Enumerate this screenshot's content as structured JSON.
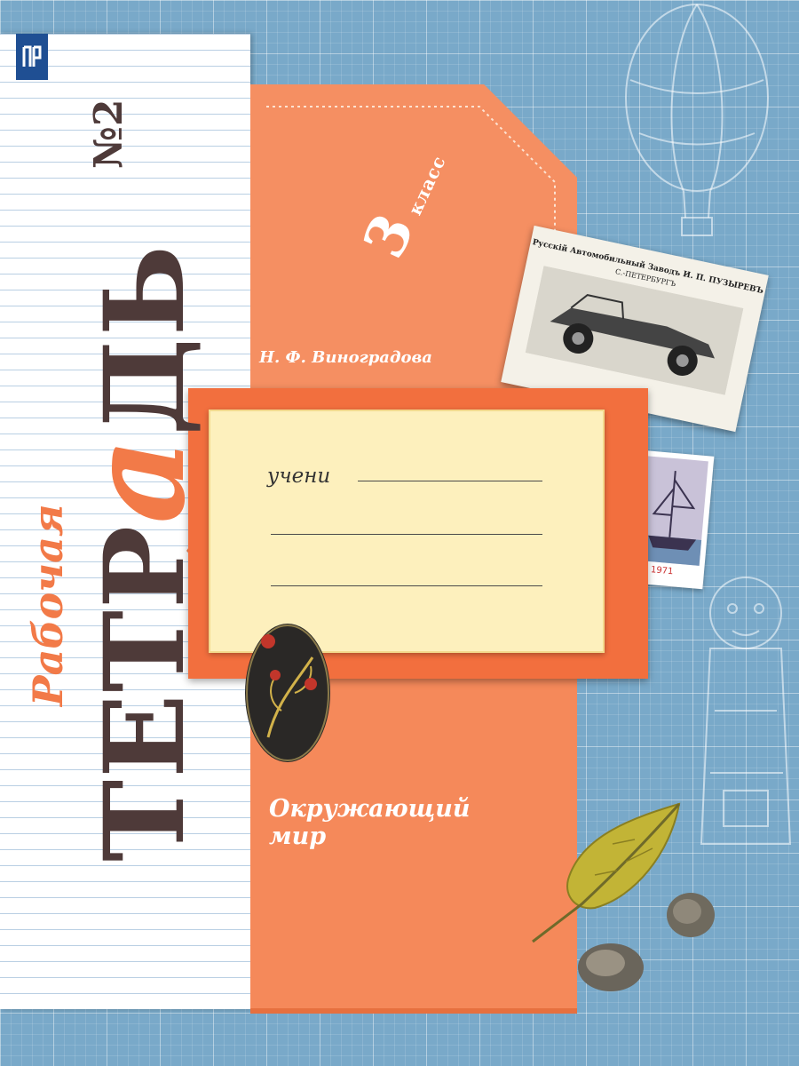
{
  "book": {
    "label": "Рабочая",
    "title_part1": "ТЕТР",
    "title_accent": "а",
    "title_part2": "ДЬ",
    "number": "№2",
    "grade_number": "3",
    "grade_word": "класс",
    "author": "Н. Ф. Виноградова",
    "subject_line1": "Окружающий",
    "subject_line2": "мир"
  },
  "card": {
    "student_label": "учени"
  },
  "decorations": {
    "postcard_title": "Русскiй Автомобильный Заводъ И. П. ПУЗЫРЕВЪ",
    "postcard_subtitle": "С.-ПЕТЕРБУРГЪ",
    "stamp_year": "1971"
  },
  "colors": {
    "background": "#79a9c9",
    "envelope": "#f5895a",
    "accent": "#f27a48",
    "title": "#4e3a39",
    "card": "#fdf0bd",
    "publisher": "#1f4f93"
  },
  "icons": [
    "publisher-logo-icon",
    "balloon-icon",
    "leaf-icon",
    "stone-icon",
    "khokhloma-medallion-icon",
    "car-icon",
    "ship-stamp-icon"
  ]
}
